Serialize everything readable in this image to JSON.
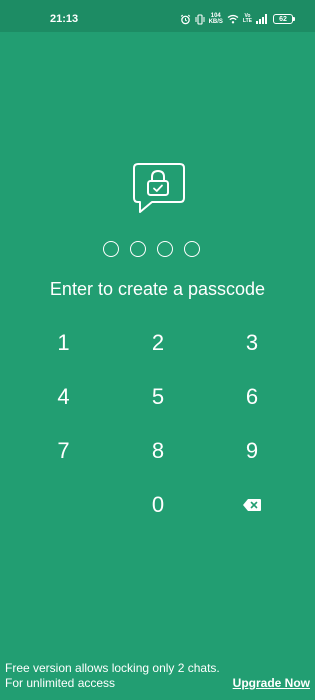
{
  "status_bar": {
    "time": "21:13",
    "net_speed_value": "104",
    "net_speed_unit": "KB/S",
    "network_label_top": "Vo",
    "network_label_bottom": "LTE",
    "battery_level": "62",
    "icons": [
      "alarm-icon",
      "vibrate-icon",
      "wifi-icon",
      "signal-icon",
      "battery-icon"
    ]
  },
  "lock_screen": {
    "icon": "chat-lock-icon",
    "pin_length": 4,
    "prompt": "Enter to create a passcode"
  },
  "keypad": {
    "keys": [
      "1",
      "2",
      "3",
      "4",
      "5",
      "6",
      "7",
      "8",
      "9",
      "",
      "0",
      "backspace"
    ],
    "backspace_icon": "backspace-icon"
  },
  "footer": {
    "line1": "Free version allows locking only 2 chats.",
    "line2": "For unlimited access",
    "upgrade_label": "Upgrade Now"
  },
  "colors": {
    "background": "#229e72",
    "status_bar": "#1d8c64",
    "foreground": "#ffffff"
  }
}
